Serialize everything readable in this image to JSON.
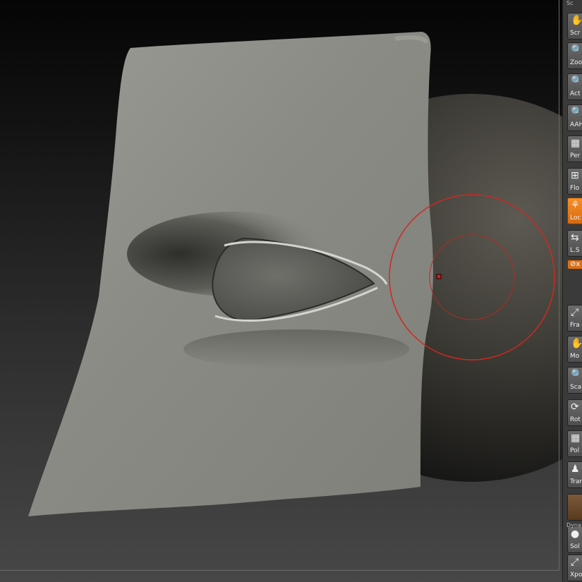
{
  "shelf": {
    "top_tag": "Sc",
    "items": [
      {
        "label": "Scr",
        "icon": "hand-icon",
        "glyph": "✋",
        "state": "normal"
      },
      {
        "label": "Zoo",
        "icon": "zoom-icon",
        "glyph": "🔍",
        "state": "normal"
      },
      {
        "label": "Act",
        "icon": "actual-size-icon",
        "glyph": "🔍",
        "state": "normal"
      },
      {
        "label": "AAH",
        "icon": "antialias-half-icon",
        "glyph": "🔍",
        "state": "normal"
      },
      {
        "label": "Per",
        "icon": "perspective-icon",
        "glyph": "▦",
        "state": "normal"
      },
      {
        "label": "Flo",
        "icon": "floor-grid-icon",
        "glyph": "⊞",
        "state": "normal"
      },
      {
        "label": "Loc",
        "icon": "local-symmetry-icon",
        "glyph": "⚘",
        "state": "active"
      },
      {
        "label": "L.S",
        "icon": "local-sym-axis-icon",
        "glyph": "⇆",
        "state": "normal"
      },
      {
        "label": "Fra",
        "icon": "frame-icon",
        "glyph": "⤢",
        "state": "normal"
      },
      {
        "label": "Mo",
        "icon": "move-hand-icon",
        "glyph": "✋",
        "state": "normal"
      },
      {
        "label": "Sca",
        "icon": "scale-icon",
        "glyph": "🔍",
        "state": "normal"
      },
      {
        "label": "Rot",
        "icon": "rotate-icon",
        "glyph": "⟳",
        "state": "normal"
      },
      {
        "label": "Pol",
        "icon": "polyframe-icon",
        "glyph": "▦",
        "state": "normal"
      },
      {
        "label": "Tran",
        "icon": "transparency-icon",
        "glyph": "♟",
        "state": "normal"
      },
      {
        "label": "",
        "icon": "ghost-icon",
        "glyph": "",
        "state": "dim"
      },
      {
        "label": "Sol",
        "icon": "solo-icon",
        "glyph": "●",
        "state": "normal"
      },
      {
        "label": "Xpo",
        "icon": "xpose-icon",
        "glyph": "⤢",
        "state": "normal"
      }
    ],
    "dynamic_tag": "Dyna",
    "toggle_label": "⊘x"
  },
  "colors": {
    "brush_outer": "#cc2a22",
    "brush_inner": "#b52a24",
    "mesh": "#8e8f88",
    "sphere": "#3a3833"
  }
}
